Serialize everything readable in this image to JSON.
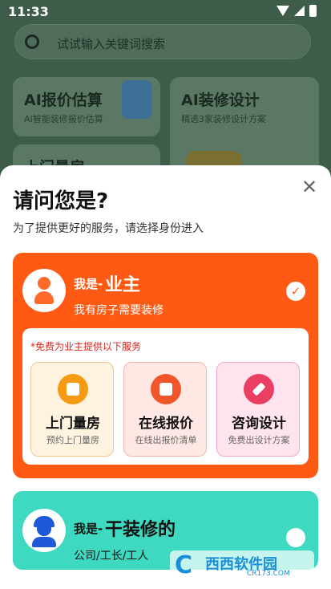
{
  "status_bar": {
    "time": "11:33"
  },
  "background": {
    "search_placeholder": "试试输入关键词搜索",
    "cards": [
      {
        "title": "AI报价估算",
        "subtitle": "AI智能装修报价估算"
      },
      {
        "title": "AI装修设计",
        "subtitle": "精选3家装修设计方案"
      },
      {
        "title": "上门量房"
      }
    ]
  },
  "sheet": {
    "title": "请问您是?",
    "subtitle": "为了提供更好的服务，请选择身份进入",
    "close_label": "✕",
    "owner": {
      "prefix": "我是-",
      "name": "业主",
      "desc": "我有房子需要装修",
      "selected_mark": "✓",
      "services_title": "*免费为业主提供以下服务",
      "services": [
        {
          "name": "上门量房",
          "desc": "预约上门量房",
          "icon": "measure-icon"
        },
        {
          "name": "在线报价",
          "desc": "在线出报价清单",
          "icon": "calculator-icon"
        },
        {
          "name": "咨询设计",
          "desc": "免费出设计方案",
          "icon": "pen-icon"
        }
      ]
    },
    "worker": {
      "prefix": "我是-",
      "name": "干装修的",
      "desc": "公司/工长/工人"
    }
  },
  "watermark": {
    "logo": "C",
    "name": "西西软件园",
    "url": "CR173.COM"
  },
  "colors": {
    "owner_card": "#ff5a14",
    "worker_card": "#3ed9c0",
    "services_title": "#e0211a"
  }
}
